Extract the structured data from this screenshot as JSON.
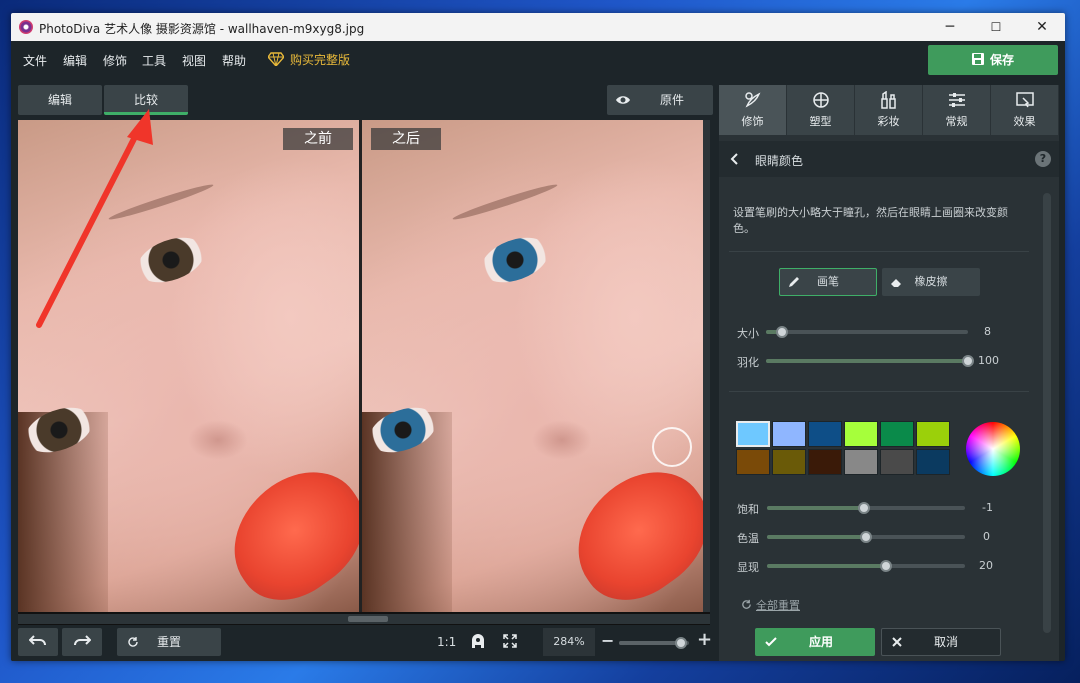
{
  "window": {
    "title": "PhotoDiva 艺术人像 摄影资源馆 - wallhaven-m9xyg8.jpg",
    "controls": [
      "─",
      "☐",
      "✕"
    ]
  },
  "menu": {
    "items": [
      "文件",
      "编辑",
      "修饰",
      "工具",
      "视图",
      "帮助"
    ],
    "buy_label": "购买完整版",
    "save_label": "保存"
  },
  "tabs": {
    "edit": "编辑",
    "compare": "比较",
    "original": "原件"
  },
  "canvas": {
    "before_label": "之前",
    "after_label": "之后",
    "brush_preview_visible": true
  },
  "bottom": {
    "reset_label": "重置",
    "one_to_one": "1:1",
    "zoom_value": "284%",
    "zoom_minus": "−",
    "zoom_plus": "+",
    "zoom_level": 0.88
  },
  "rightpanel": {
    "tabs": [
      {
        "label": "修饰",
        "icon": "retouch-icon"
      },
      {
        "label": "塑型",
        "icon": "reshape-icon"
      },
      {
        "label": "彩妆",
        "icon": "makeup-icon"
      },
      {
        "label": "常规",
        "icon": "adjust-icon"
      },
      {
        "label": "效果",
        "icon": "effects-icon"
      }
    ],
    "section_title": "眼睛颜色",
    "help": "?",
    "description": "设置笔刷的大小略大于瞳孔，然后在眼睛上画圈来改变颜色。",
    "brush_label": "画笔",
    "eraser_label": "橡皮擦",
    "sliders": [
      {
        "label": "大小",
        "value": "8",
        "level": 0.08
      },
      {
        "label": "羽化",
        "value": "100",
        "level": 1.0
      }
    ],
    "colors": [
      "#6ec8ff",
      "#8fb6ff",
      "#0e4e87",
      "#a6ff3b",
      "#0a8a4a",
      "#9bd00a",
      "#7a4a08",
      "#6a5a08",
      "#3a1a08",
      "#888888",
      "#4a4a4a",
      "#0b3a60"
    ],
    "adjust_sliders": [
      {
        "label": "饱和",
        "value": "-1",
        "level": 0.49
      },
      {
        "label": "色温",
        "value": "0",
        "level": 0.5
      },
      {
        "label": "显现",
        "value": "20",
        "level": 0.6
      }
    ],
    "reset_all": "全部重置",
    "apply": "应用",
    "cancel": "取消"
  }
}
